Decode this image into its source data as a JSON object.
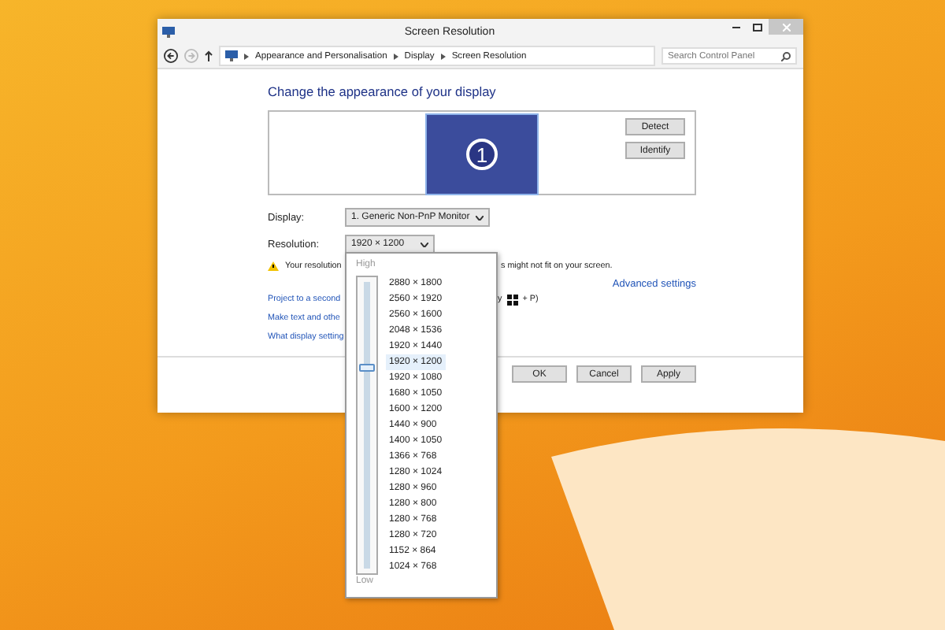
{
  "window": {
    "title": "Screen Resolution"
  },
  "address_bar": {
    "breadcrumbs": [
      "Appearance and Personalisation",
      "Display",
      "Screen Resolution"
    ],
    "search": {
      "placeholder": "Search Control Panel"
    }
  },
  "heading": "Change the appearance of your display",
  "monitor": {
    "number": "1"
  },
  "side_buttons": [
    "Detect",
    "Identify"
  ],
  "display": {
    "label": "Display:",
    "value": "1. Generic Non-PnP Monitor"
  },
  "resolution": {
    "label": "Resolution:",
    "value": "1920 × 1200"
  },
  "warning": {
    "start": "Your resolution",
    "end": "s might not fit on your screen."
  },
  "advanced_link": "Advanced settings",
  "links": [
    {
      "text": "Project to a second",
      "tail_start": "y",
      "tail_end": "+ P)"
    },
    {
      "text": "Make text and othe"
    },
    {
      "text": "What display setting"
    }
  ],
  "buttons": [
    "OK",
    "Cancel",
    "Apply"
  ],
  "resolution_popup": {
    "high": "High",
    "low": "Low",
    "level": 0.722,
    "options": [
      {
        "text": "2880 × 1800",
        "selected": false
      },
      {
        "text": "2560 × 1920",
        "selected": false
      },
      {
        "text": "2560 × 1600",
        "selected": false
      },
      {
        "text": "2048 × 1536",
        "selected": false
      },
      {
        "text": "1920 × 1440",
        "selected": false
      },
      {
        "text": "1920 × 1200",
        "selected": true
      },
      {
        "text": "1920 × 1080",
        "selected": false
      },
      {
        "text": "1680 × 1050",
        "selected": false
      },
      {
        "text": "1600 × 1200",
        "selected": false
      },
      {
        "text": "1440 × 900",
        "selected": false
      },
      {
        "text": "1400 × 1050",
        "selected": false
      },
      {
        "text": "1366 × 768",
        "selected": false
      },
      {
        "text": "1280 × 1024",
        "selected": false
      },
      {
        "text": "1280 × 960",
        "selected": false
      },
      {
        "text": "1280 × 800",
        "selected": false
      },
      {
        "text": "1280 × 768",
        "selected": false
      },
      {
        "text": "1280 × 720",
        "selected": false
      },
      {
        "text": "1152 × 864",
        "selected": false
      },
      {
        "text": "1024 × 768",
        "selected": false
      }
    ]
  }
}
